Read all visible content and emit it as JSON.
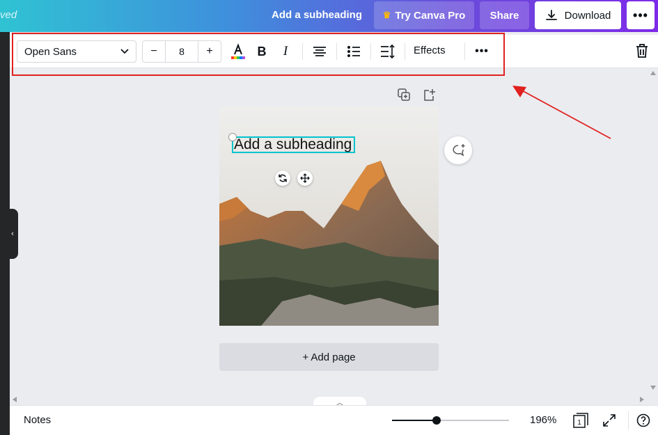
{
  "header": {
    "saved_status": "ved",
    "doc_title": "Add a subheading",
    "try_pro_label": "Try Canva Pro",
    "share_label": "Share",
    "download_label": "Download",
    "more_label": "•••"
  },
  "toolbar": {
    "font_family": "Open Sans",
    "font_size": "8",
    "decrease_label": "−",
    "increase_label": "+",
    "effects_label": "Effects",
    "more_label": "•••"
  },
  "canvas": {
    "text_element": "Add a subheading",
    "add_page_label": "+ Add page"
  },
  "footer": {
    "notes_label": "Notes",
    "zoom_label": "196%",
    "zoom_slider_fraction": 0.38,
    "page_count": "1"
  },
  "colors": {
    "brand_gradient_start": "#2fc3d3",
    "brand_gradient_end": "#7d2ae8",
    "selection": "#00c4cc",
    "annotation": "#e0211f"
  }
}
